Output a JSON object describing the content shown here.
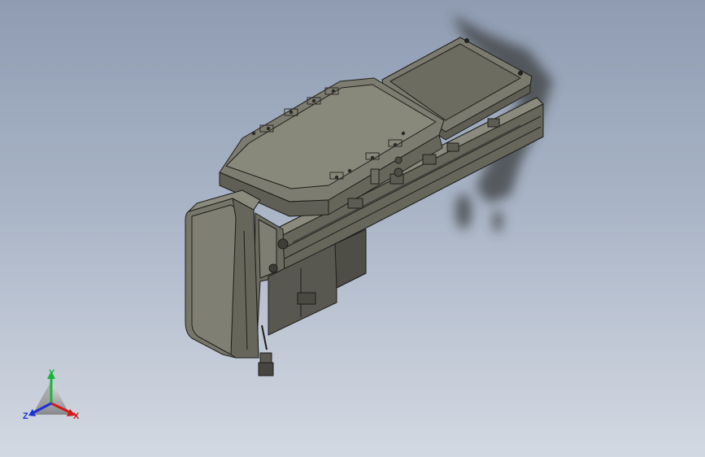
{
  "viewport": {
    "background_top": "#8f9cb2",
    "background_bottom": "#d3d9e2"
  },
  "model": {
    "body_color": "#76766a",
    "highlight_color": "#8b8b7e",
    "shadow_color": "#5a5a50",
    "edge_color": "#1e1e1a"
  },
  "triad": {
    "x_label": "X",
    "y_label": "Y",
    "z_label": "Z",
    "x_color": "#d11a1a",
    "y_color": "#18b53a",
    "z_color": "#1c2fd8"
  }
}
